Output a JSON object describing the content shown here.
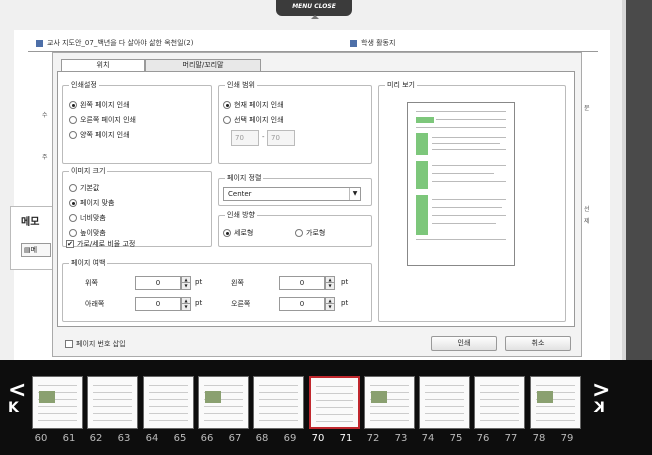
{
  "top_menu": {
    "close_label": "MENU CLOSE"
  },
  "background_page": {
    "left_heading": "교사 지도안_07_백년을 다 살아야 삶한 옥천일(2)",
    "right_heading": "학생 활동지",
    "memo_title": "메모",
    "memo_button": "메",
    "side_marks": [
      "수",
      "주",
      "문",
      "선",
      "제"
    ]
  },
  "dialog": {
    "tabs": [
      {
        "label": "위치",
        "active": true
      },
      {
        "label": "머리말/꼬리말",
        "active": false
      }
    ],
    "print_settings": {
      "legend": "인쇄설정",
      "options": [
        {
          "label": "왼쪽 페이지 인쇄",
          "checked": true
        },
        {
          "label": "오른쪽 페이지 인쇄",
          "checked": false
        },
        {
          "label": "양쪽 페이지 인쇄",
          "checked": false
        }
      ]
    },
    "print_range": {
      "legend": "인쇄 범위",
      "options": [
        {
          "label": "현재 페이지 인쇄",
          "checked": true
        },
        {
          "label": "선택 페이지 인쇄",
          "checked": false
        }
      ],
      "from": "70",
      "separator": "-",
      "to": "70"
    },
    "preview": {
      "legend": "미리 보기"
    },
    "image_size": {
      "legend": "이미지 크기",
      "options": [
        {
          "label": "기본값",
          "checked": false
        },
        {
          "label": "페이지 맞춤",
          "checked": true
        },
        {
          "label": "너비맞춤",
          "checked": false
        },
        {
          "label": "높이맞춤",
          "checked": false
        }
      ]
    },
    "page_align": {
      "legend": "페이지 정렬",
      "value": "Center"
    },
    "orientation": {
      "legend": "인쇄 방향",
      "options": [
        {
          "label": "세로형",
          "checked": true
        },
        {
          "label": "가로형",
          "checked": false
        }
      ]
    },
    "keep_ratio": {
      "label": "가로/세로 비율 고정",
      "checked": true
    },
    "margins": {
      "legend": "페이지 여백",
      "top": {
        "label": "위쪽",
        "value": "0",
        "unit": "pt"
      },
      "left": {
        "label": "왼쪽",
        "value": "0",
        "unit": "pt"
      },
      "bottom": {
        "label": "아래쪽",
        "value": "0",
        "unit": "pt"
      },
      "right": {
        "label": "오른쪽",
        "value": "0",
        "unit": "pt"
      }
    },
    "page_number": {
      "label": "페이지 번호 삽입",
      "checked": false
    },
    "print_button": "인쇄",
    "cancel_button": "취소"
  },
  "thumbnails": {
    "prev_arrow": "<",
    "first_arrow": "K",
    "next_arrow": ">",
    "last_arrow": "K",
    "spreads": [
      {
        "left": "60",
        "right": "61"
      },
      {
        "left": "62",
        "right": "63"
      },
      {
        "left": "64",
        "right": "65"
      },
      {
        "left": "66",
        "right": "67"
      },
      {
        "left": "68",
        "right": "69"
      },
      {
        "left": "70",
        "right": "71",
        "selected": true
      },
      {
        "left": "72",
        "right": "73"
      },
      {
        "left": "74",
        "right": "75"
      },
      {
        "left": "76",
        "right": "77"
      },
      {
        "left": "78",
        "right": "79"
      }
    ]
  },
  "colors": {
    "accent_selected": "#c0272d",
    "preview_green": "#7dc77b"
  }
}
